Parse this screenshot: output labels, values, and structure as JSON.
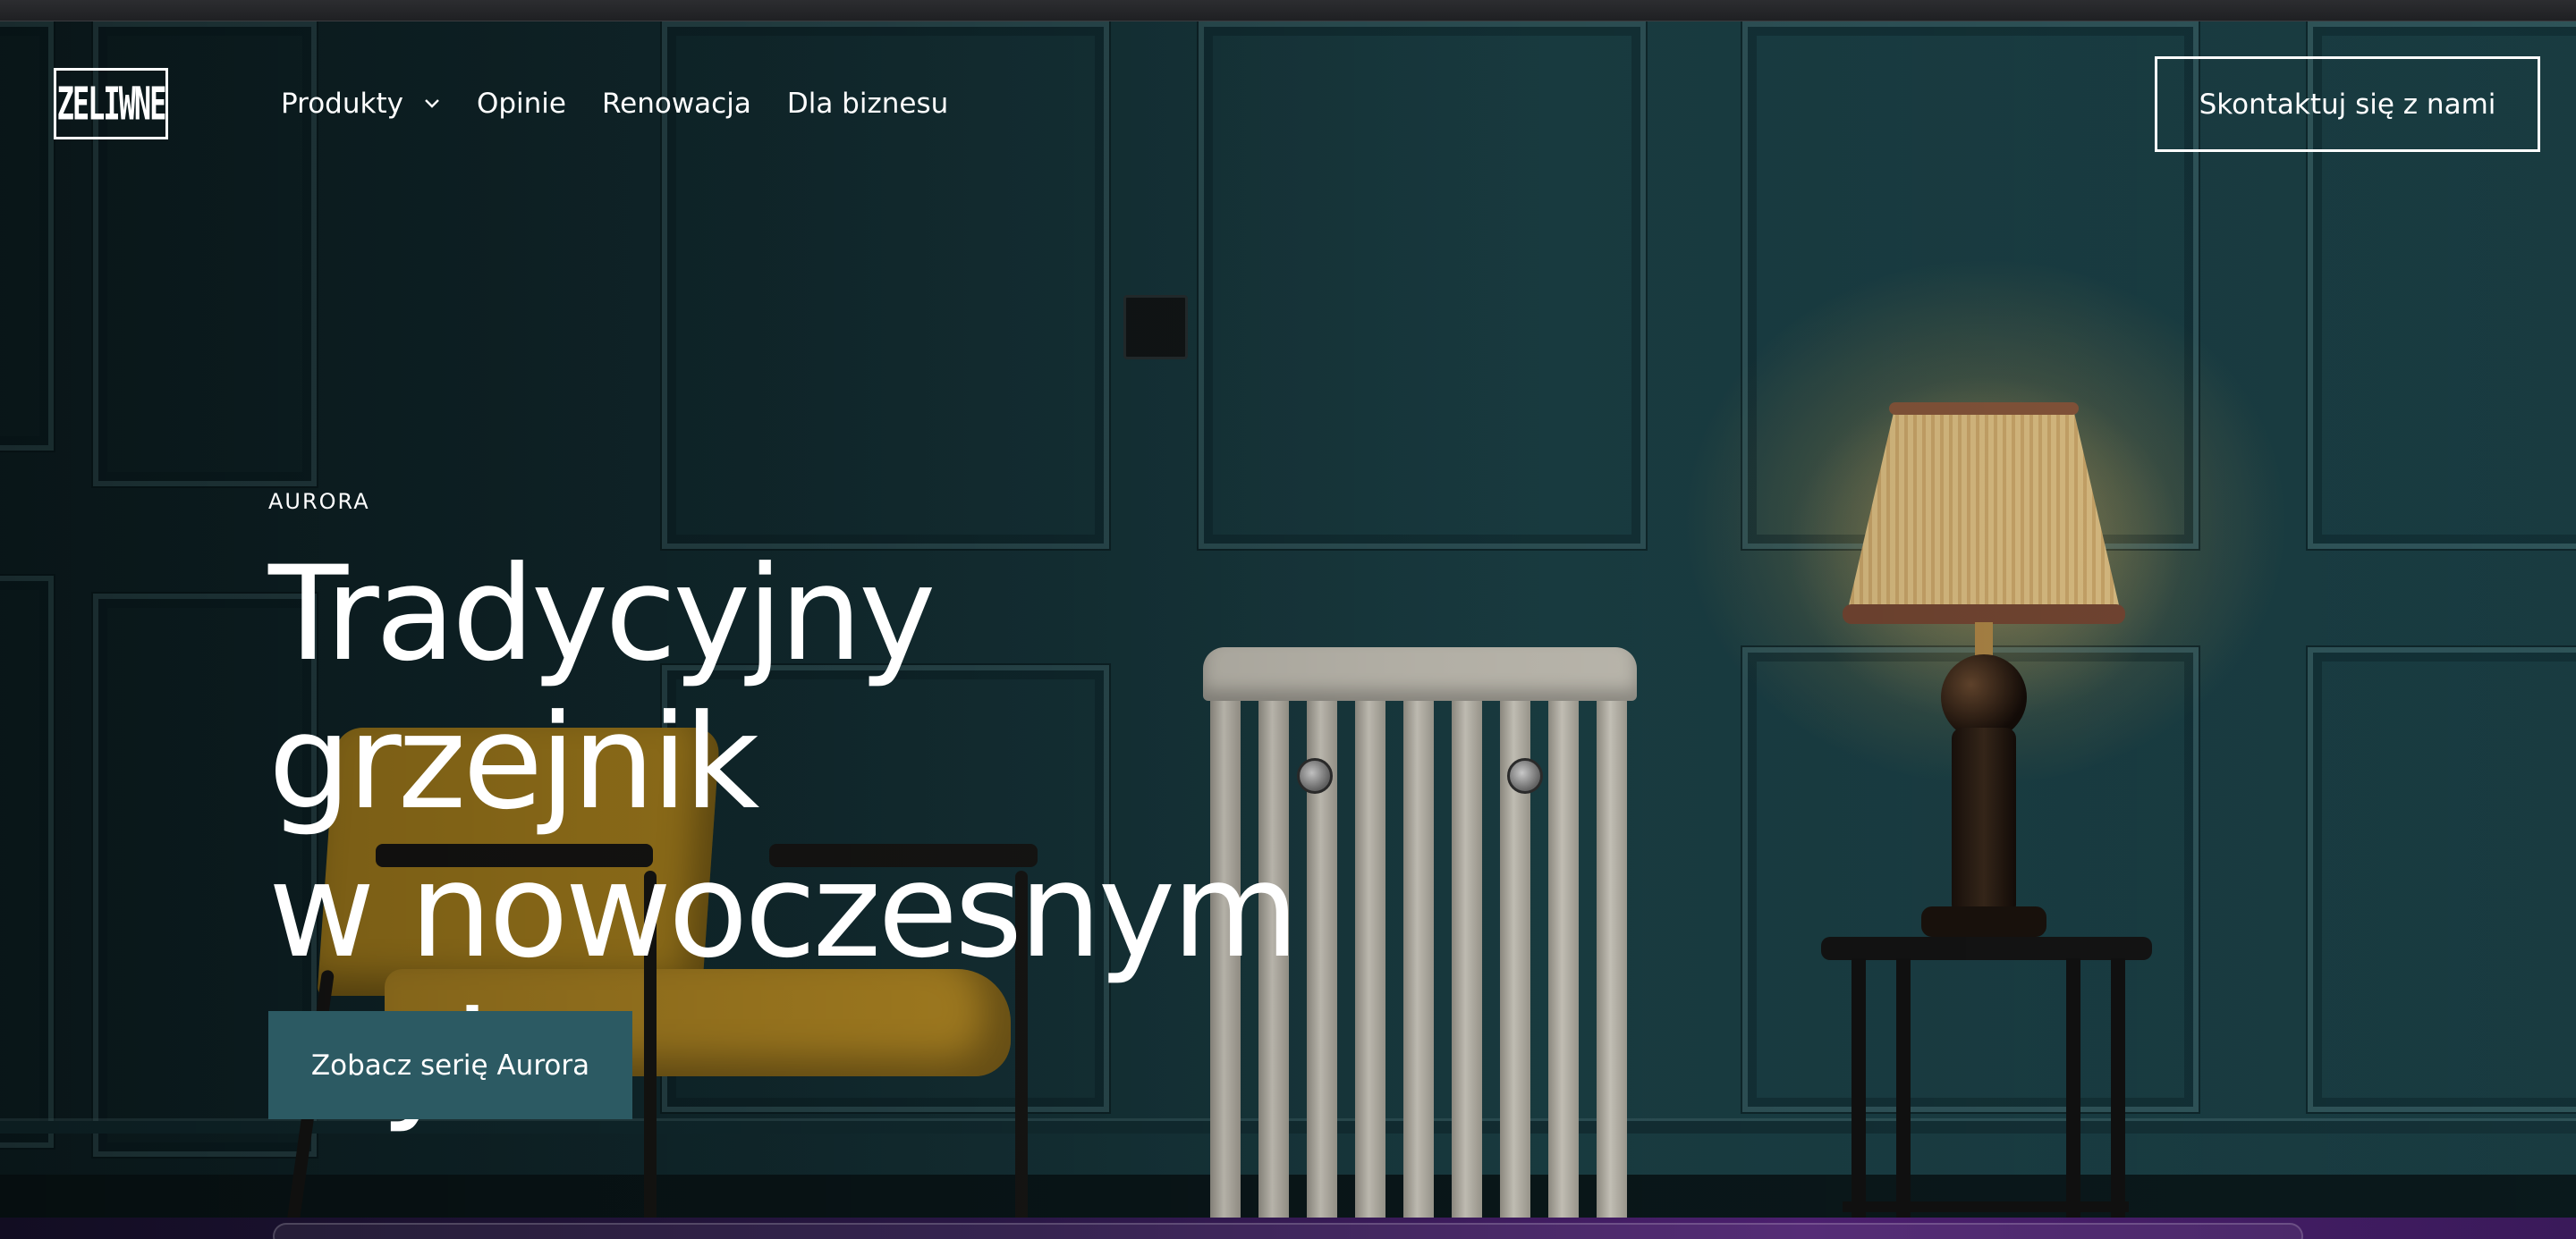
{
  "header": {
    "logo_text": "ZELIWNE",
    "nav_items": [
      {
        "label": "Produkty",
        "has_dropdown": true
      },
      {
        "label": "Opinie"
      },
      {
        "label": "Renowacja"
      },
      {
        "label": "Dla biznesu"
      }
    ],
    "contact_label": "Skontaktuj się z nami"
  },
  "hero": {
    "eyebrow": "AURORA",
    "headline_lines": [
      "Tradycyjny grzejnik",
      "w nowoczesnym",
      "stylu"
    ],
    "cta_label": "Zobacz serię Aurora"
  },
  "icons": {
    "dropdown": "chevron-down-icon",
    "logo": "zeliwne-logo"
  },
  "colors": {
    "cta_background": "#2c5a63",
    "wall": "#17373d",
    "text": "#ffffff"
  }
}
